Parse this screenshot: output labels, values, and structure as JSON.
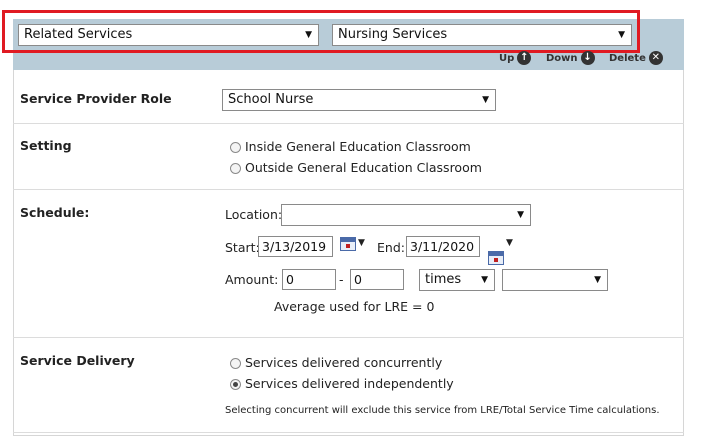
{
  "header": {
    "category_select": "Related Services",
    "service_select": "Nursing Services",
    "up_label": "Up",
    "down_label": "Down",
    "delete_label": "Delete"
  },
  "provider": {
    "label": "Service Provider Role",
    "value": "School Nurse"
  },
  "setting": {
    "label": "Setting",
    "options": [
      "Inside General Education Classroom",
      "Outside General Education Classroom"
    ],
    "selected": null
  },
  "schedule": {
    "label": "Schedule:",
    "location_label": "Location:",
    "location_value": "",
    "start_label": "Start:",
    "start_value": "3/13/2019",
    "end_label": "End:",
    "end_value": "3/11/2020",
    "amount_label": "Amount:",
    "amount_from": "0",
    "amount_sep": "-",
    "amount_to": "0",
    "unit_value": "times",
    "frequency_value": "",
    "lre_note": "Average used for LRE = 0"
  },
  "delivery": {
    "label": "Service Delivery",
    "options": [
      "Services delivered concurrently",
      "Services delivered independently"
    ],
    "selected_index": 1,
    "note": "Selecting concurrent will exclude this service from LRE/Total Service Time calculations."
  },
  "icons": {
    "dropdown": "chevron-down-icon",
    "up": "arrow-up-icon",
    "down": "arrow-down-icon",
    "delete": "close-icon",
    "calendar": "calendar-icon"
  },
  "colors": {
    "header_bg": "#b8ccd8",
    "highlight": "#e01a22"
  }
}
